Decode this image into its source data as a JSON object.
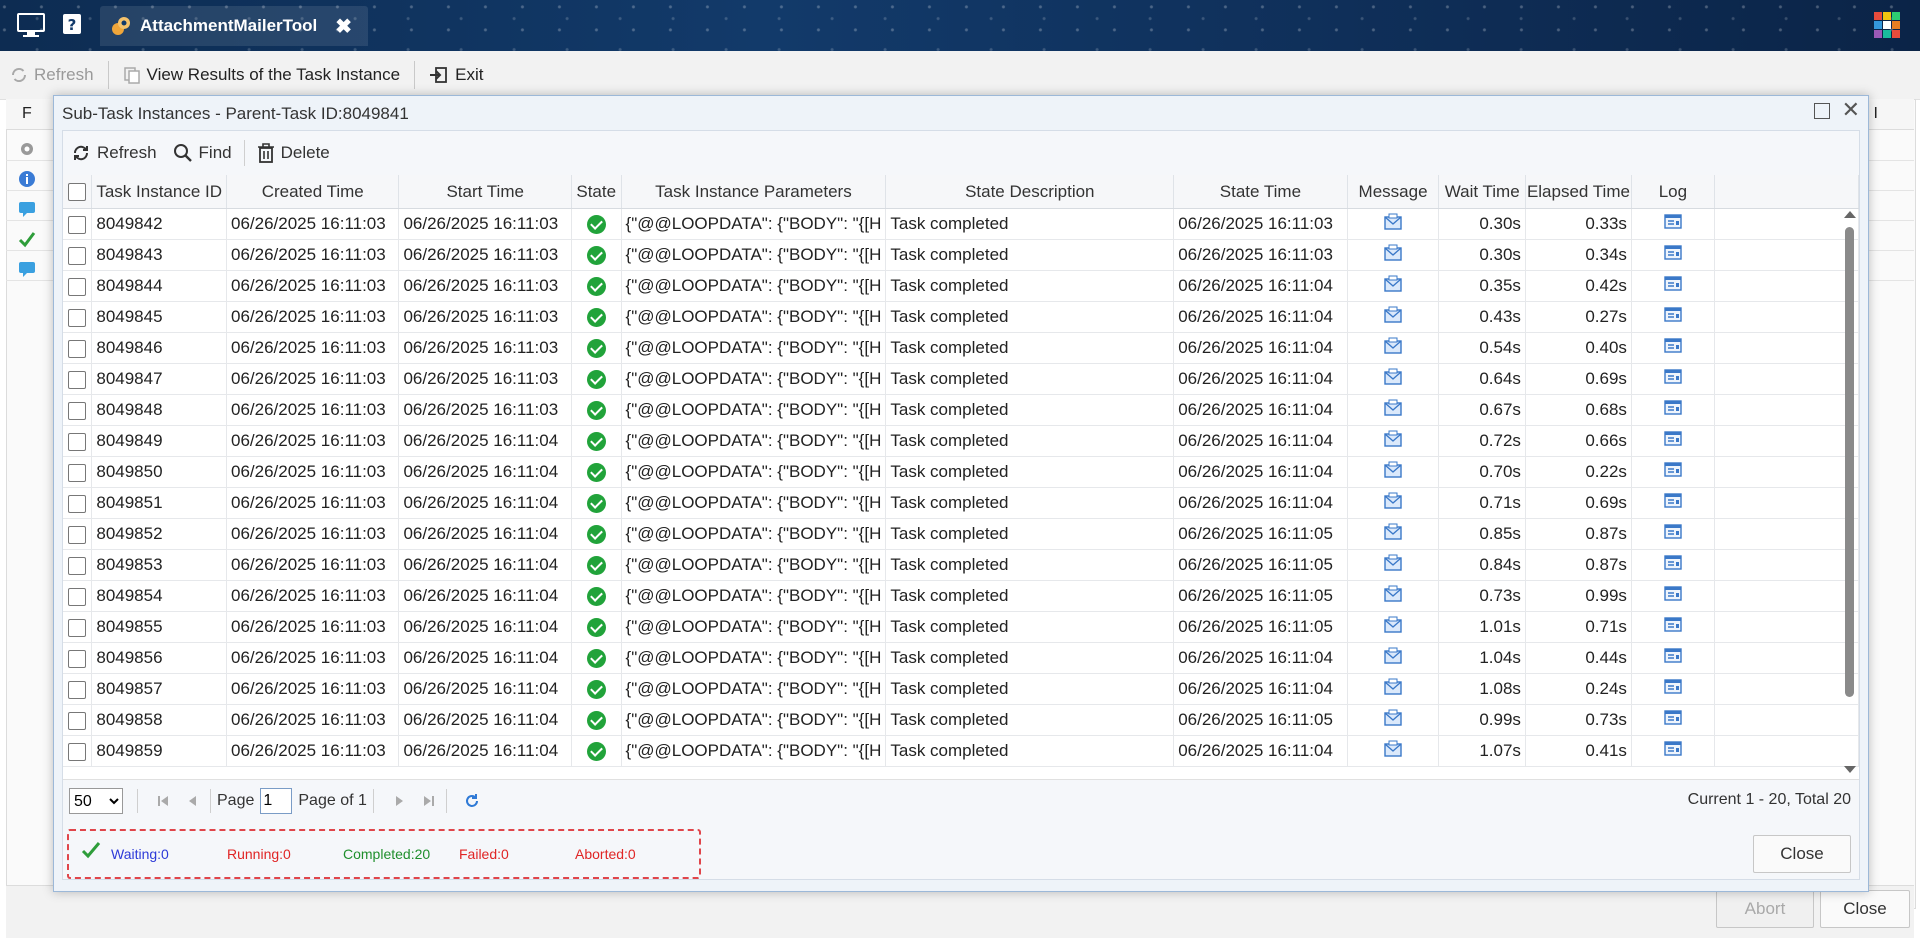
{
  "window": {
    "tab_title": "AttachmentMailerTool",
    "tab_close": "✖"
  },
  "back_toolbar": {
    "refresh": "Refresh",
    "view_results": "View Results of the Task Instance",
    "exit": "Exit"
  },
  "back_grid": {
    "first_header": "F",
    "last_header": "I"
  },
  "back_footer": {
    "abort": "Abort",
    "close": "Close"
  },
  "dialog": {
    "title": "Sub-Task Instances - Parent-Task ID:8049841",
    "toolbar": {
      "refresh": "Refresh",
      "find": "Find",
      "delete": "Delete"
    },
    "columns": [
      "Task Instance ID",
      "Created Time",
      "Start Time",
      "State",
      "Task Instance Parameters",
      "State Description",
      "State Time",
      "Message",
      "Wait Time",
      "Elapsed Time",
      "Log"
    ],
    "rows": [
      {
        "id": "8049842",
        "created": "06/26/2025 16:11:03",
        "start": "06/26/2025 16:11:03",
        "params": "{\"@@LOOPDATA\": {\"BODY\": \"{[H",
        "desc": "Task completed",
        "state_time": "06/26/2025 16:11:03",
        "wait": "0.30s",
        "elapsed": "0.33s"
      },
      {
        "id": "8049843",
        "created": "06/26/2025 16:11:03",
        "start": "06/26/2025 16:11:03",
        "params": "{\"@@LOOPDATA\": {\"BODY\": \"{[H",
        "desc": "Task completed",
        "state_time": "06/26/2025 16:11:03",
        "wait": "0.30s",
        "elapsed": "0.34s"
      },
      {
        "id": "8049844",
        "created": "06/26/2025 16:11:03",
        "start": "06/26/2025 16:11:03",
        "params": "{\"@@LOOPDATA\": {\"BODY\": \"{[H",
        "desc": "Task completed",
        "state_time": "06/26/2025 16:11:04",
        "wait": "0.35s",
        "elapsed": "0.42s"
      },
      {
        "id": "8049845",
        "created": "06/26/2025 16:11:03",
        "start": "06/26/2025 16:11:03",
        "params": "{\"@@LOOPDATA\": {\"BODY\": \"{[H",
        "desc": "Task completed",
        "state_time": "06/26/2025 16:11:04",
        "wait": "0.43s",
        "elapsed": "0.27s"
      },
      {
        "id": "8049846",
        "created": "06/26/2025 16:11:03",
        "start": "06/26/2025 16:11:03",
        "params": "{\"@@LOOPDATA\": {\"BODY\": \"{[H",
        "desc": "Task completed",
        "state_time": "06/26/2025 16:11:04",
        "wait": "0.54s",
        "elapsed": "0.40s"
      },
      {
        "id": "8049847",
        "created": "06/26/2025 16:11:03",
        "start": "06/26/2025 16:11:03",
        "params": "{\"@@LOOPDATA\": {\"BODY\": \"{[H",
        "desc": "Task completed",
        "state_time": "06/26/2025 16:11:04",
        "wait": "0.64s",
        "elapsed": "0.69s"
      },
      {
        "id": "8049848",
        "created": "06/26/2025 16:11:03",
        "start": "06/26/2025 16:11:03",
        "params": "{\"@@LOOPDATA\": {\"BODY\": \"{[H",
        "desc": "Task completed",
        "state_time": "06/26/2025 16:11:04",
        "wait": "0.67s",
        "elapsed": "0.68s"
      },
      {
        "id": "8049849",
        "created": "06/26/2025 16:11:03",
        "start": "06/26/2025 16:11:04",
        "params": "{\"@@LOOPDATA\": {\"BODY\": \"{[H",
        "desc": "Task completed",
        "state_time": "06/26/2025 16:11:04",
        "wait": "0.72s",
        "elapsed": "0.66s"
      },
      {
        "id": "8049850",
        "created": "06/26/2025 16:11:03",
        "start": "06/26/2025 16:11:04",
        "params": "{\"@@LOOPDATA\": {\"BODY\": \"{[H",
        "desc": "Task completed",
        "state_time": "06/26/2025 16:11:04",
        "wait": "0.70s",
        "elapsed": "0.22s"
      },
      {
        "id": "8049851",
        "created": "06/26/2025 16:11:03",
        "start": "06/26/2025 16:11:04",
        "params": "{\"@@LOOPDATA\": {\"BODY\": \"{[H",
        "desc": "Task completed",
        "state_time": "06/26/2025 16:11:04",
        "wait": "0.71s",
        "elapsed": "0.69s"
      },
      {
        "id": "8049852",
        "created": "06/26/2025 16:11:03",
        "start": "06/26/2025 16:11:04",
        "params": "{\"@@LOOPDATA\": {\"BODY\": \"{[H",
        "desc": "Task completed",
        "state_time": "06/26/2025 16:11:05",
        "wait": "0.85s",
        "elapsed": "0.87s"
      },
      {
        "id": "8049853",
        "created": "06/26/2025 16:11:03",
        "start": "06/26/2025 16:11:04",
        "params": "{\"@@LOOPDATA\": {\"BODY\": \"{[H",
        "desc": "Task completed",
        "state_time": "06/26/2025 16:11:05",
        "wait": "0.84s",
        "elapsed": "0.87s"
      },
      {
        "id": "8049854",
        "created": "06/26/2025 16:11:03",
        "start": "06/26/2025 16:11:04",
        "params": "{\"@@LOOPDATA\": {\"BODY\": \"{[H",
        "desc": "Task completed",
        "state_time": "06/26/2025 16:11:05",
        "wait": "0.73s",
        "elapsed": "0.99s"
      },
      {
        "id": "8049855",
        "created": "06/26/2025 16:11:03",
        "start": "06/26/2025 16:11:04",
        "params": "{\"@@LOOPDATA\": {\"BODY\": \"{[H",
        "desc": "Task completed",
        "state_time": "06/26/2025 16:11:05",
        "wait": "1.01s",
        "elapsed": "0.71s"
      },
      {
        "id": "8049856",
        "created": "06/26/2025 16:11:03",
        "start": "06/26/2025 16:11:04",
        "params": "{\"@@LOOPDATA\": {\"BODY\": \"{[H",
        "desc": "Task completed",
        "state_time": "06/26/2025 16:11:04",
        "wait": "1.04s",
        "elapsed": "0.44s"
      },
      {
        "id": "8049857",
        "created": "06/26/2025 16:11:03",
        "start": "06/26/2025 16:11:04",
        "params": "{\"@@LOOPDATA\": {\"BODY\": \"{[H",
        "desc": "Task completed",
        "state_time": "06/26/2025 16:11:04",
        "wait": "1.08s",
        "elapsed": "0.24s"
      },
      {
        "id": "8049858",
        "created": "06/26/2025 16:11:03",
        "start": "06/26/2025 16:11:04",
        "params": "{\"@@LOOPDATA\": {\"BODY\": \"{[H",
        "desc": "Task completed",
        "state_time": "06/26/2025 16:11:05",
        "wait": "0.99s",
        "elapsed": "0.73s"
      },
      {
        "id": "8049859",
        "created": "06/26/2025 16:11:03",
        "start": "06/26/2025 16:11:04",
        "params": "{\"@@LOOPDATA\": {\"BODY\": \"{[H",
        "desc": "Task completed",
        "state_time": "06/26/2025 16:11:04",
        "wait": "1.07s",
        "elapsed": "0.41s"
      }
    ],
    "pager": {
      "page_size": "50",
      "page_label": "Page",
      "page_value": "1",
      "page_of": "Page of 1",
      "total": "Current 1 - 20, Total 20"
    },
    "status": {
      "waiting": "Waiting:0",
      "running": "Running:0",
      "completed": "Completed:20",
      "failed": "Failed:0",
      "aborted": "Aborted:0"
    },
    "close": "Close"
  },
  "colors": {
    "accent": "#2c4fd6",
    "success": "#21a33a",
    "danger": "#e02525",
    "dialog_border": "#9cb8d8"
  }
}
